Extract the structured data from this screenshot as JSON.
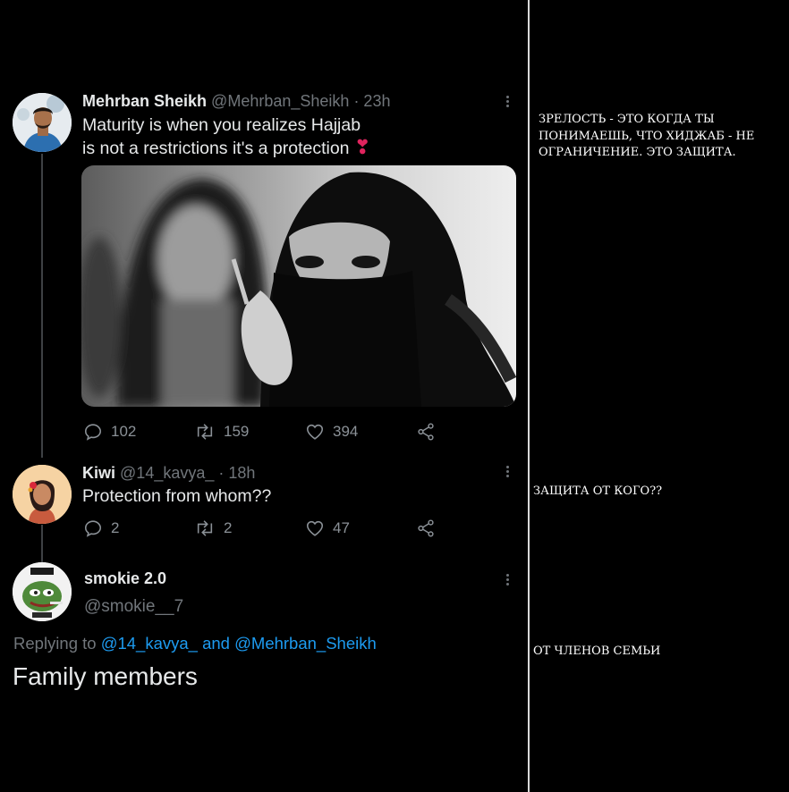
{
  "tweet1": {
    "author_name": "Mehrban Sheikh",
    "handle": "@Mehrban_Sheikh",
    "time": "· 23h",
    "text_line1": "Maturity is when you realizes Hajjab",
    "text_line2": "is not a restrictions it's a protection",
    "emoji": "❣",
    "replies": "102",
    "retweets": "159",
    "likes": "394"
  },
  "tweet2": {
    "author_name": "Kiwi",
    "handle": "@14_kavya_",
    "time": "· 18h",
    "text": "Protection from whom??",
    "replies": "2",
    "retweets": "2",
    "likes": "47"
  },
  "tweet3": {
    "author_name": "smokie 2.0",
    "handle": "@smokie__7",
    "replying_to_prefix": "Replying to",
    "replying_to_user1": "@14_kavya_",
    "replying_conjunction": "and",
    "replying_to_user2": "@Mehrban_Sheikh",
    "text": "Family members"
  },
  "translations": {
    "t1": "ЗРЕЛОСТЬ - ЭТО КОГДА ТЫ ПОНИМАЕШЬ, ЧТО ХИДЖАБ - НЕ ОГРАНИЧЕНИЕ. ЭТО ЗАЩИТА.",
    "t2": "ЗАЩИТА ОТ КОГО??",
    "t3": "ОТ ЧЛЕНОВ СЕМЬИ"
  },
  "colors": {
    "background": "#000000",
    "link": "#1d9bf0",
    "text": "#e7e9ea",
    "muted": "#71767b",
    "heart_emoji": "#e0245e"
  },
  "icons": [
    "reply-icon",
    "retweet-icon",
    "like-icon",
    "share-icon",
    "more-icon"
  ]
}
